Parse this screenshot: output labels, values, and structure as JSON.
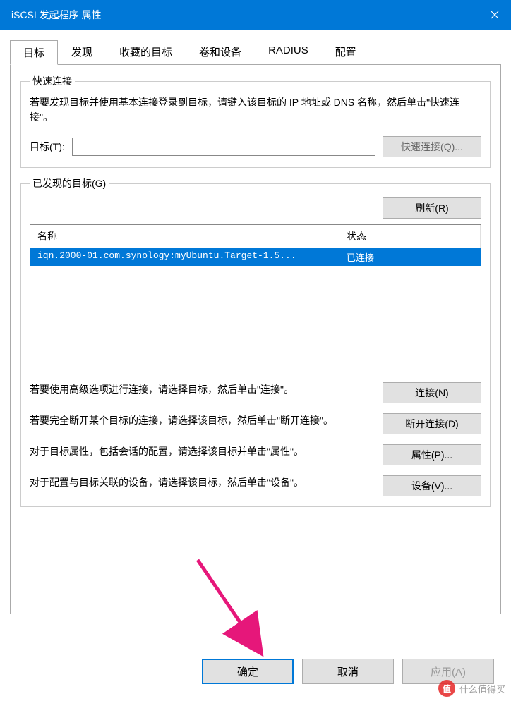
{
  "titlebar": {
    "title": "iSCSI 发起程序 属性"
  },
  "tabs": [
    {
      "label": "目标",
      "active": true
    },
    {
      "label": "发现"
    },
    {
      "label": "收藏的目标"
    },
    {
      "label": "卷和设备"
    },
    {
      "label": "RADIUS"
    },
    {
      "label": "配置"
    }
  ],
  "quick_connect": {
    "legend": "快速连接",
    "desc": "若要发现目标并使用基本连接登录到目标，请键入该目标的 IP 地址或 DNS 名称，然后单击\"快速连接\"。",
    "target_label": "目标(T):",
    "target_value": "",
    "button": "快速连接(Q)..."
  },
  "discovered": {
    "legend": "已发现的目标(G)",
    "refresh": "刷新(R)",
    "cols": {
      "name": "名称",
      "status": "状态"
    },
    "rows": [
      {
        "name": "iqn.2000-01.com.synology:myUbuntu.Target-1.5...",
        "status": "已连接"
      }
    ],
    "actions": [
      {
        "text": "若要使用高级选项进行连接，请选择目标，然后单击\"连接\"。",
        "button": "连接(N)"
      },
      {
        "text": "若要完全断开某个目标的连接，请选择该目标，然后单击\"断开连接\"。",
        "button": "断开连接(D)"
      },
      {
        "text": "对于目标属性，包括会话的配置，请选择该目标并单击\"属性\"。",
        "button": "属性(P)..."
      },
      {
        "text": "对于配置与目标关联的设备，请选择该目标，然后单击\"设备\"。",
        "button": "设备(V)..."
      }
    ]
  },
  "dialog_buttons": {
    "ok": "确定",
    "cancel": "取消",
    "apply": "应用(A)"
  },
  "watermark": {
    "logo": "值",
    "text": "什么值得买"
  }
}
